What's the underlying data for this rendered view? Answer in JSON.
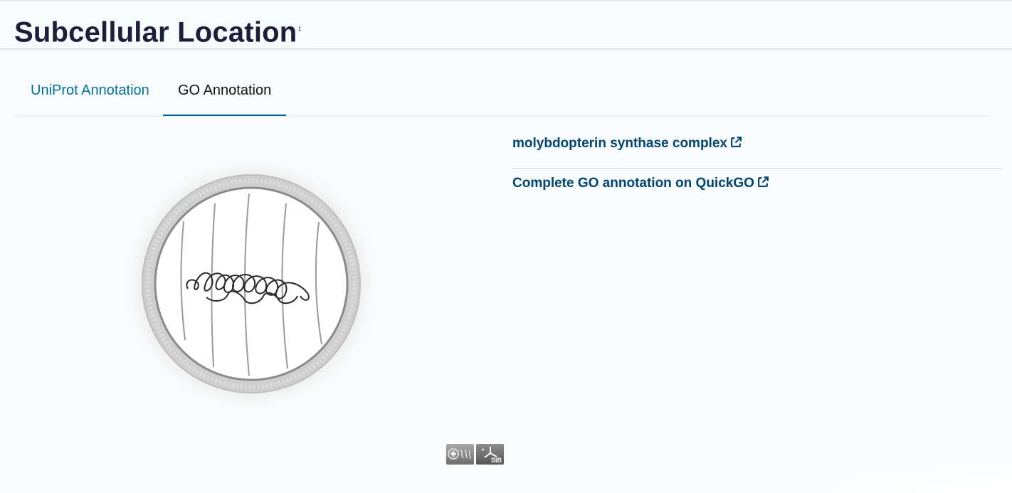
{
  "header": {
    "title": "Subcellular Location",
    "info_marker": "i"
  },
  "tabs": [
    {
      "label": "UniProt Annotation",
      "active": false
    },
    {
      "label": "GO Annotation",
      "active": true
    }
  ],
  "go_annotation": {
    "terms": [
      {
        "label": "molybdopterin synthase complex",
        "icon": "external-link-icon"
      }
    ],
    "quickgo_link": {
      "label": "Complete GO annotation on QuickGO",
      "icon": "external-link-icon"
    }
  },
  "diagram": {
    "name": "cell-diagram"
  },
  "footer": {
    "logo_b_text": "SIB"
  },
  "colors": {
    "title": "#1b1f3a",
    "tab_inactive": "#00709b",
    "tab_active_underline": "#00639e",
    "link": "#014371"
  }
}
